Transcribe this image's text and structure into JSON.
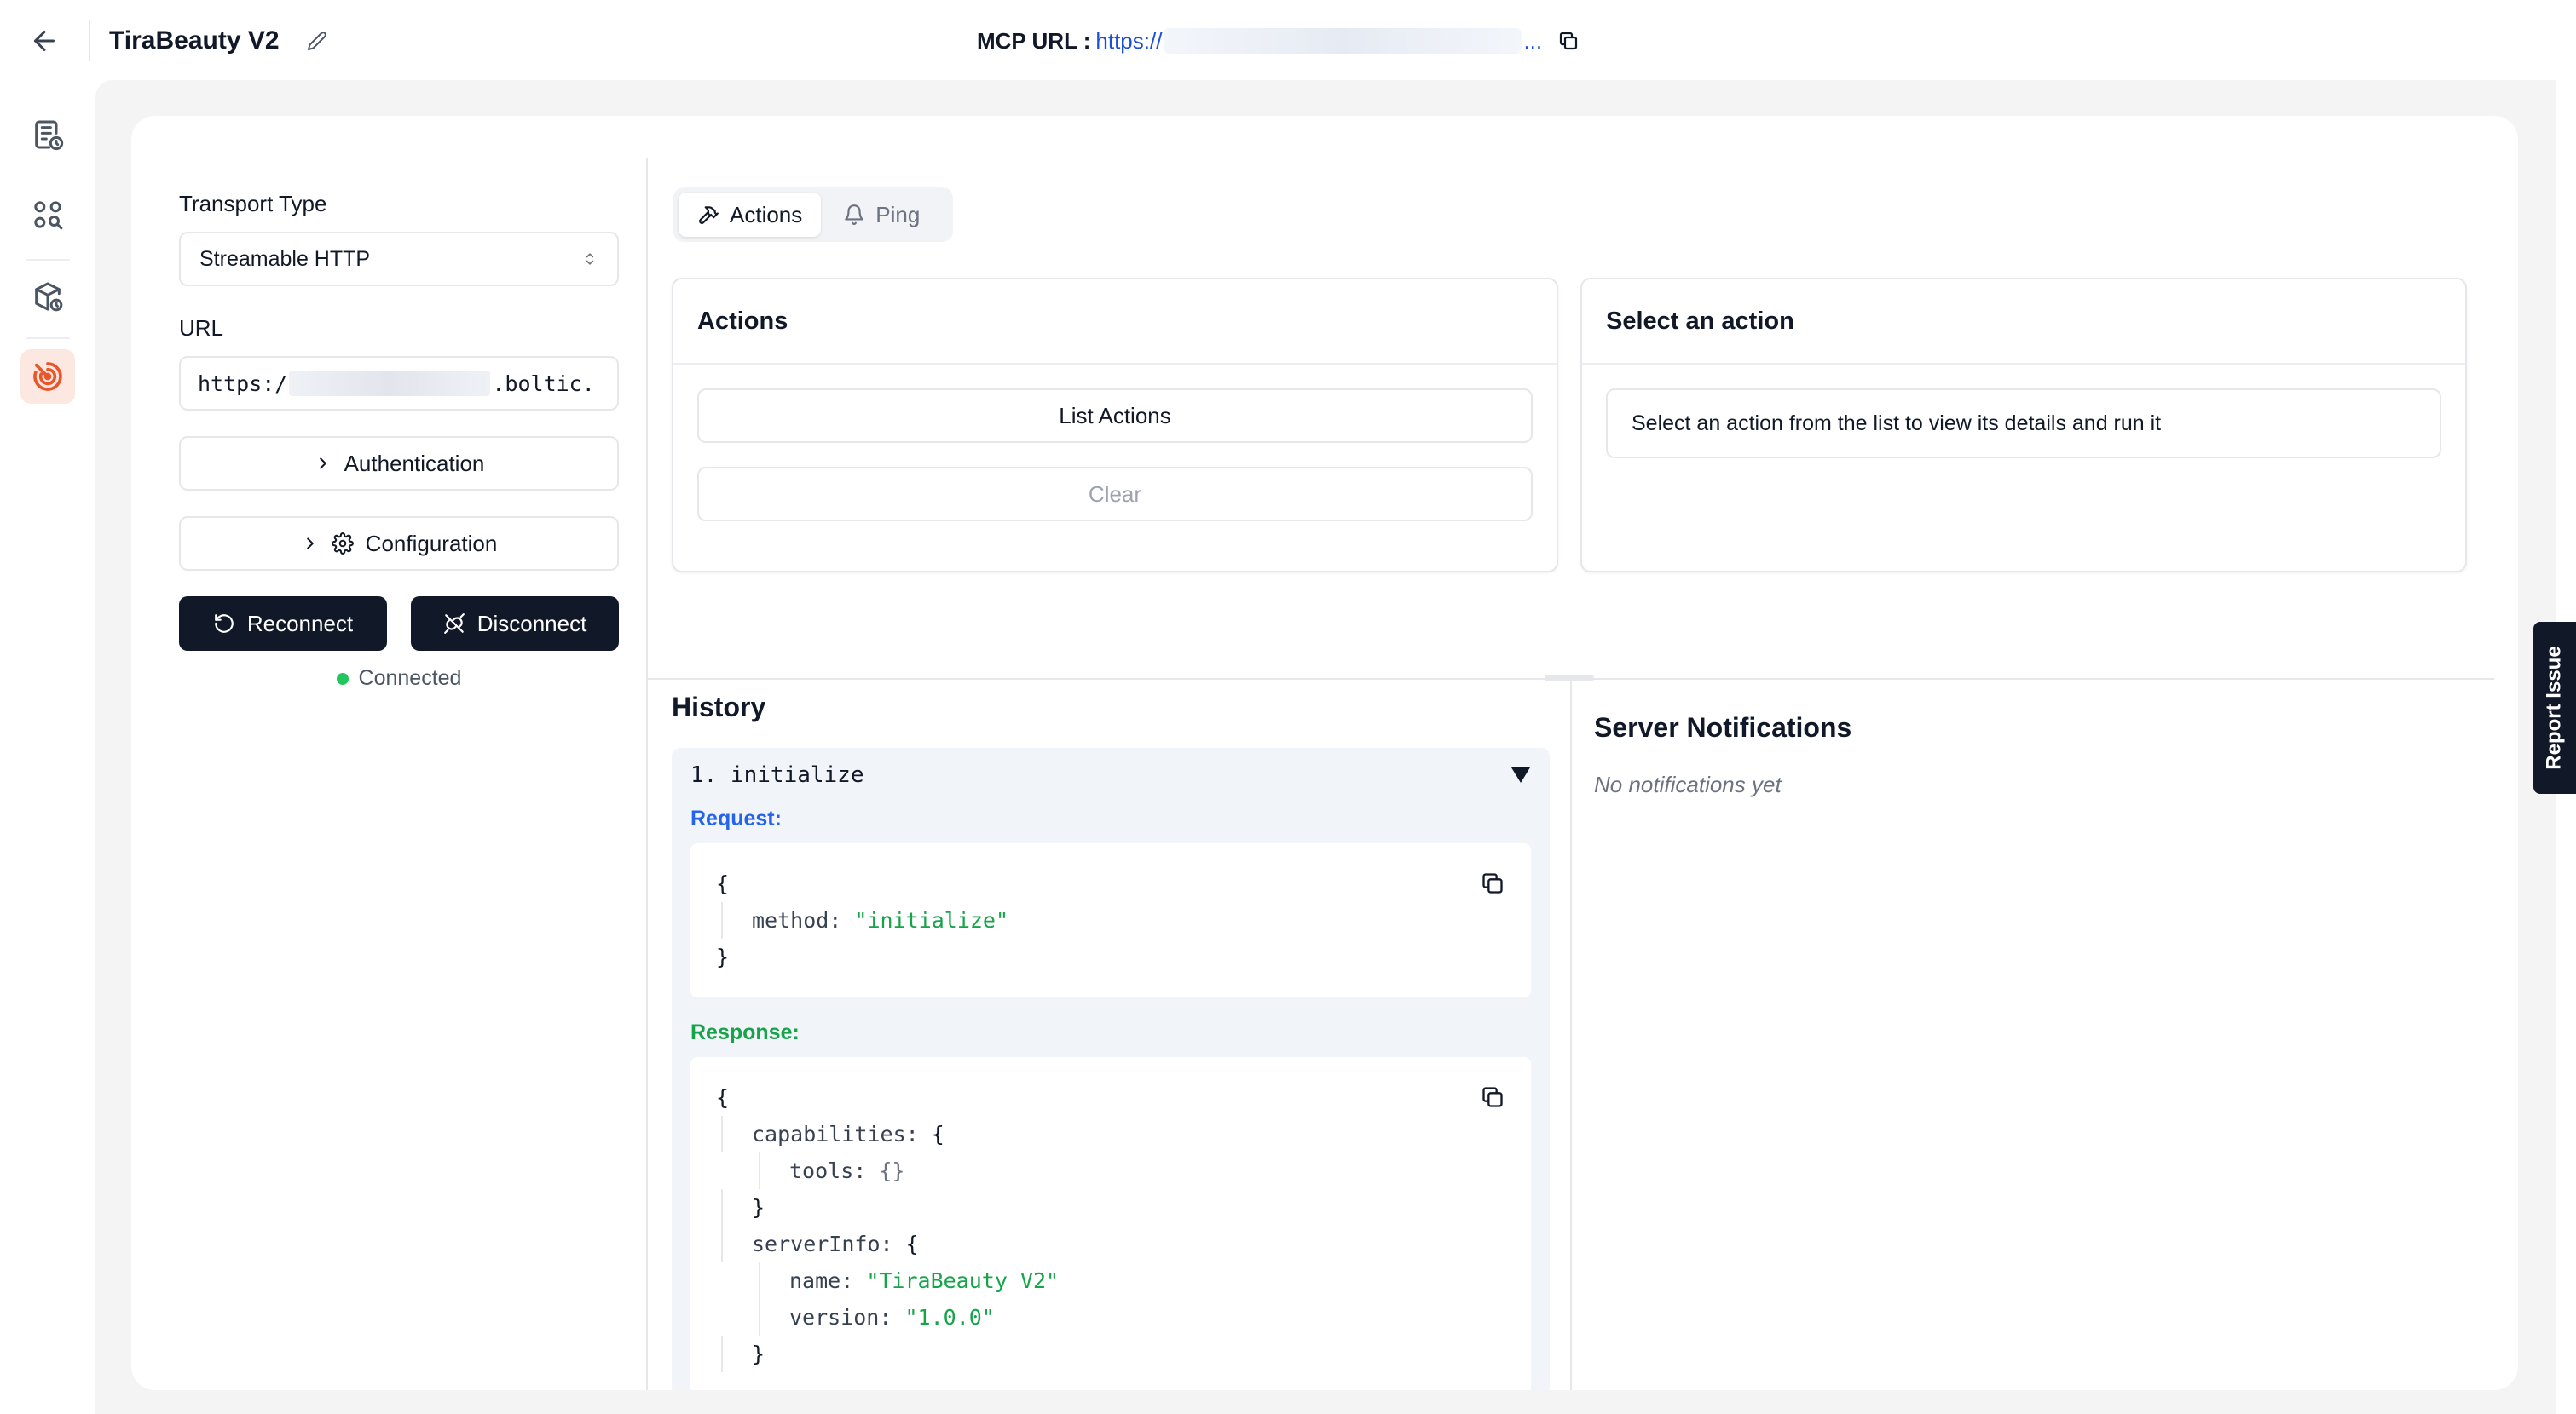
{
  "header": {
    "title": "TiraBeauty V2",
    "mcp_label": "MCP URL :",
    "mcp_url_prefix": "https://",
    "mcp_url_suffix": "..."
  },
  "sidebar": {
    "items": [
      {
        "icon": "document-clock-icon"
      },
      {
        "icon": "grid-search-icon"
      },
      {
        "icon": "package-clock-icon"
      },
      {
        "icon": "broadcast-icon",
        "active": true
      }
    ]
  },
  "config": {
    "transport_label": "Transport Type",
    "transport_value": "Streamable HTTP",
    "url_label": "URL",
    "url_prefix": "https:/",
    "url_suffix": ".boltic.",
    "authentication_label": "Authentication",
    "configuration_label": "Configuration",
    "reconnect_label": "Reconnect",
    "disconnect_label": "Disconnect",
    "status": "Connected"
  },
  "tabs": [
    {
      "label": "Actions",
      "active": true
    },
    {
      "label": "Ping",
      "active": false
    }
  ],
  "actions_panel": {
    "title": "Actions",
    "list_button": "List Actions",
    "clear_button": "Clear"
  },
  "select_panel": {
    "title": "Select an action",
    "message": "Select an action from the list to view its details and run it"
  },
  "history": {
    "title": "History",
    "item_title": "1. initialize",
    "request_label": "Request:",
    "response_label": "Response:",
    "request": {
      "brace_open": "{",
      "key": "method:",
      "value": "\"initialize\"",
      "brace_close": "}"
    },
    "response": {
      "brace_open": "{",
      "capabilities_key": "capabilities:",
      "obj_open": "{",
      "tools_key": "tools:",
      "tools_value": "{}",
      "obj_close": "}",
      "serverinfo_key": "serverInfo:",
      "name_key": "name:",
      "name_value": "\"TiraBeauty V2\"",
      "version_key": "version:",
      "version_value": "\"1.0.0\""
    }
  },
  "notifications": {
    "title": "Server Notifications",
    "empty": "No notifications yet"
  },
  "report_issue": "Report Issue",
  "colors": {
    "accent": "#e8562a",
    "dark_button": "#111827",
    "connected": "#22c55e",
    "request": "#2563eb",
    "response": "#16a34a"
  }
}
